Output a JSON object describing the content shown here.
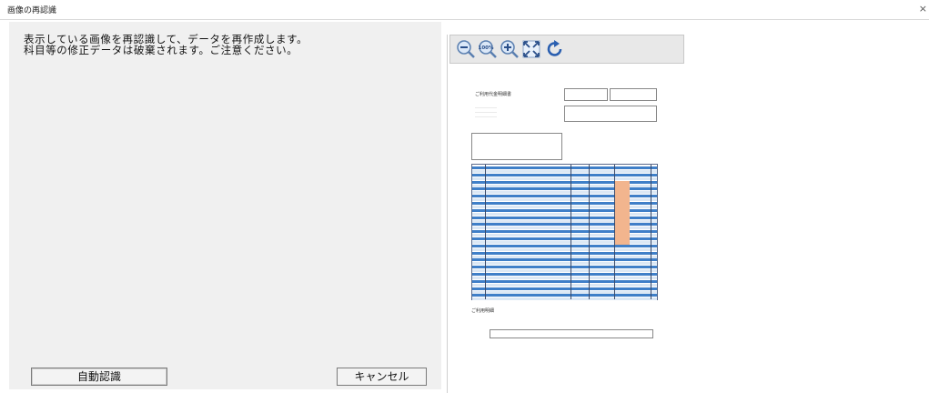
{
  "window": {
    "title": "画像の再認識",
    "close_glyph": "×"
  },
  "message": {
    "line1": "表示している画像を再認識して、データを再作成します。",
    "line2": "科目等の修正データは破棄されます。ご注意ください。"
  },
  "buttons": {
    "auto_recognize": "自動認識",
    "cancel": "キャンセル"
  },
  "toolbar": {
    "zoom_100_label": "100%"
  },
  "document": {
    "title": "ご利用代金明細書",
    "section_heading": "ご利用明細"
  }
}
